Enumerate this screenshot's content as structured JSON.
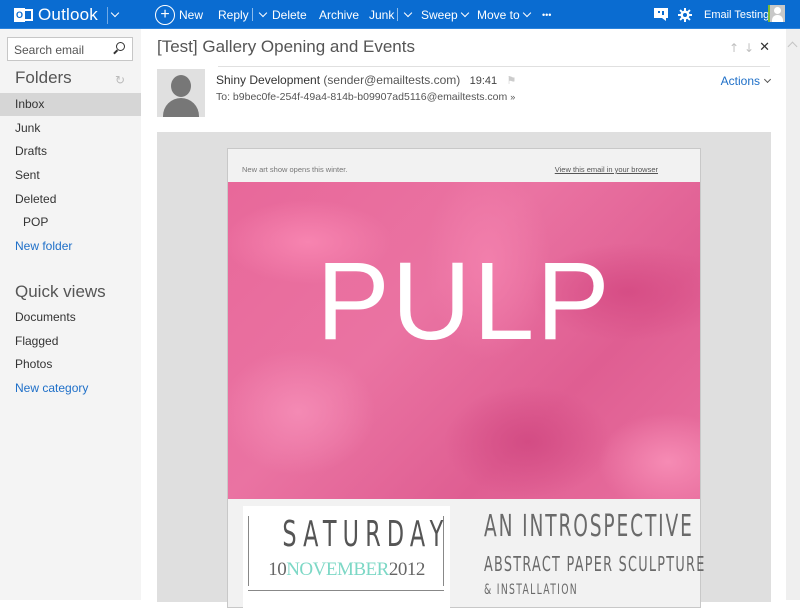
{
  "app": {
    "name": "Outlook"
  },
  "toolbar": {
    "new_label": "New",
    "reply_label": "Reply",
    "delete_label": "Delete",
    "archive_label": "Archive",
    "junk_label": "Junk",
    "sweep_label": "Sweep",
    "move_to_label": "Move to",
    "more_label": "•••",
    "user_name": "Email Testing",
    "accent_color": "#0a6cd1"
  },
  "sidebar": {
    "search_placeholder": "Search email",
    "folders_title": "Folders",
    "folders": [
      {
        "label": "Inbox",
        "selected": true
      },
      {
        "label": "Junk"
      },
      {
        "label": "Drafts"
      },
      {
        "label": "Sent"
      },
      {
        "label": "Deleted"
      },
      {
        "label": "POP"
      }
    ],
    "new_folder_label": "New folder",
    "quick_views_title": "Quick views",
    "quick_views": [
      {
        "label": "Documents"
      },
      {
        "label": "Flagged"
      },
      {
        "label": "Photos"
      }
    ],
    "new_category_label": "New category"
  },
  "message": {
    "subject": "[Test] Gallery Opening and Events",
    "sender_name": "Shiny Development",
    "sender_email": "(sender@emailtests.com)",
    "time": "19:41",
    "to_line": "To: b9bec0fe-254f-49a4-814b-b09907ad5116@emailtests.com",
    "actions_label": "Actions"
  },
  "email_body": {
    "preheader": "New art show opens this  winter.",
    "view_in_browser": "View this email in your browser",
    "hero_title": "PULP",
    "hero_color": "#e8689a",
    "day": "SATURDAY",
    "date_day": "10",
    "date_month": "NOVEMBER",
    "date_year": "2012",
    "month_color": "#7dd8c6",
    "intro_line1": "AN INTROSPECTIVE",
    "intro_line2": "ABSTRACT PAPER SCULPTURE",
    "intro_line3": "& INSTALLATION"
  }
}
